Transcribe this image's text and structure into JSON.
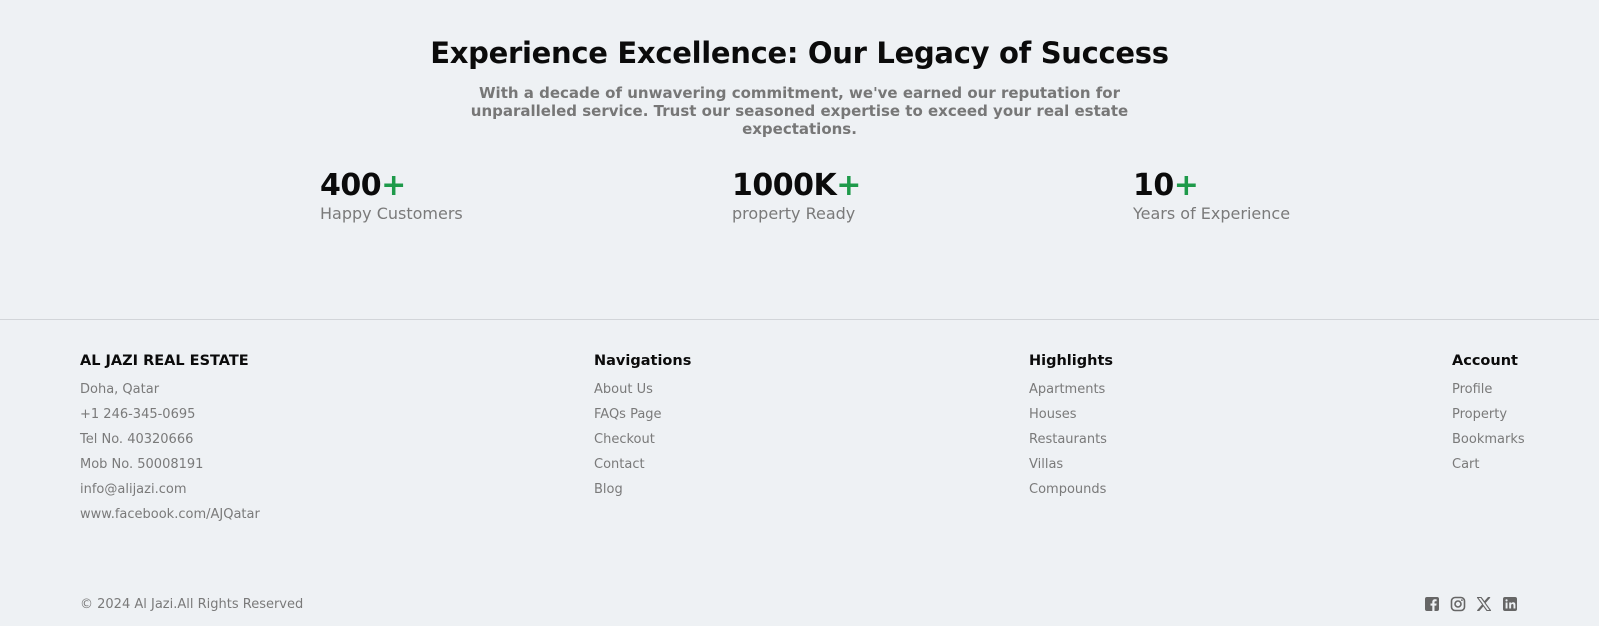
{
  "hero": {
    "title": "Experience Excellence: Our Legacy of Success",
    "subtitle": "With a decade of unwavering commitment, we've earned our reputation for unparalleled service. Trust our seasoned expertise to exceed your real estate expectations."
  },
  "stats": [
    {
      "value": "400",
      "suffix": "+",
      "label": "Happy Customers"
    },
    {
      "value": "1000K",
      "suffix": "+",
      "label": "property Ready"
    },
    {
      "value": "10",
      "suffix": "+",
      "label": "Years of Experience"
    }
  ],
  "footer": {
    "company": {
      "title": "AL JAZI REAL ESTATE",
      "items": [
        "Doha, Qatar",
        "+1 246-345-0695",
        "Tel No. 40320666",
        "Mob No. 50008191",
        "info@alijazi.com",
        "www.facebook.com/AJQatar"
      ]
    },
    "navigations": {
      "title": "Navigations",
      "items": [
        "About Us",
        "FAQs Page",
        "Checkout",
        "Contact",
        "Blog"
      ]
    },
    "highlights": {
      "title": "Highlights",
      "items": [
        "Apartments",
        "Houses",
        "Restaurants",
        "Villas",
        "Compounds"
      ]
    },
    "account": {
      "title": "Account",
      "items": [
        "Profile",
        "Property",
        "Bookmarks",
        "Cart"
      ]
    },
    "copyright": "© 2024 Al Jazi.All Rights Reserved",
    "socials": [
      "facebook-icon",
      "instagram-icon",
      "x-icon",
      "linkedin-icon"
    ]
  },
  "colors": {
    "accent": "#1e9a4a",
    "background": "#eef1f4",
    "muted": "#7a7a7a"
  }
}
